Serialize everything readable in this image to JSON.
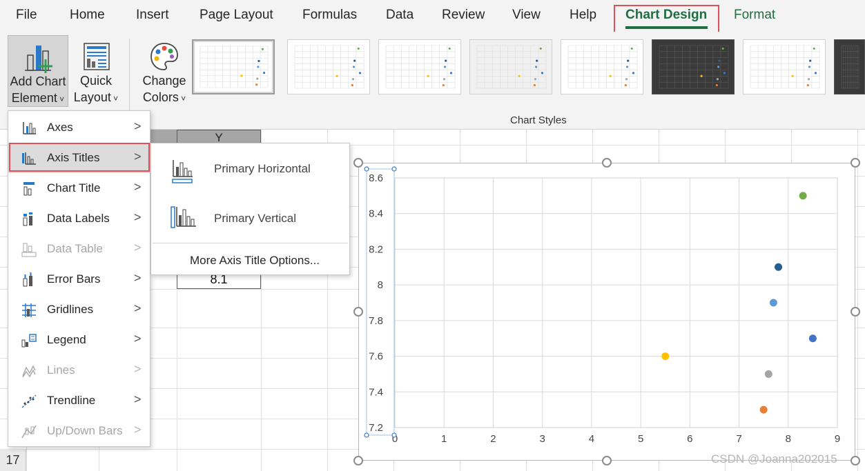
{
  "menu": {
    "tabs": [
      "File",
      "Home",
      "Insert",
      "Page Layout",
      "Formulas",
      "Data",
      "Review",
      "View",
      "Help",
      "Chart Design",
      "Format"
    ],
    "active": "Chart Design"
  },
  "ribbon": {
    "add_chart_element": {
      "line1": "Add Chart",
      "line2": "Element"
    },
    "quick_layout": {
      "line1": "Quick",
      "line2": "Layout"
    },
    "change_colors": {
      "line1": "Change",
      "line2": "Colors"
    },
    "chart_styles_label": "Chart Styles",
    "style_count": 8
  },
  "dropdown": {
    "items": [
      {
        "label": "Axes",
        "icon": "axes-icon",
        "enabled": true
      },
      {
        "label": "Axis Titles",
        "icon": "axis-titles-icon",
        "enabled": true
      },
      {
        "label": "Chart Title",
        "icon": "chart-title-icon",
        "enabled": true
      },
      {
        "label": "Data Labels",
        "icon": "data-labels-icon",
        "enabled": true
      },
      {
        "label": "Data Table",
        "icon": "data-table-icon",
        "enabled": false
      },
      {
        "label": "Error Bars",
        "icon": "error-bars-icon",
        "enabled": true
      },
      {
        "label": "Gridlines",
        "icon": "gridlines-icon",
        "enabled": true
      },
      {
        "label": "Legend",
        "icon": "legend-icon",
        "enabled": true
      },
      {
        "label": "Lines",
        "icon": "lines-icon",
        "enabled": false
      },
      {
        "label": "Trendline",
        "icon": "trendline-icon",
        "enabled": true
      },
      {
        "label": "Up/Down Bars",
        "icon": "up-down-bars-icon",
        "enabled": false
      }
    ],
    "hovered": "Axis Titles"
  },
  "submenu": {
    "primary_horizontal": "Primary Horizontal",
    "primary_vertical": "Primary Vertical",
    "more_options": "More Axis Title Options..."
  },
  "sheet": {
    "column_header": "Y",
    "cell_value": "8.1",
    "row_number": "17"
  },
  "chart_data": {
    "type": "scatter",
    "x_ticks": [
      "0",
      "1",
      "2",
      "3",
      "4",
      "5",
      "6",
      "7",
      "8",
      "9"
    ],
    "y_ticks": [
      "7.2",
      "7.4",
      "7.6",
      "7.8",
      "8",
      "8.2",
      "8.4",
      "8.6"
    ],
    "xlim": [
      0,
      9
    ],
    "ylim": [
      7.2,
      8.6
    ],
    "grid": true,
    "points": [
      {
        "x": 8.3,
        "y": 8.5,
        "color": "#70ad47"
      },
      {
        "x": 7.8,
        "y": 8.1,
        "color": "#255e91"
      },
      {
        "x": 7.7,
        "y": 7.9,
        "color": "#5b9bd5"
      },
      {
        "x": 8.5,
        "y": 7.7,
        "color": "#4472c4"
      },
      {
        "x": 5.5,
        "y": 7.6,
        "color": "#ffc000"
      },
      {
        "x": 7.6,
        "y": 7.5,
        "color": "#a5a5a5"
      },
      {
        "x": 7.5,
        "y": 7.3,
        "color": "#ed7d31"
      }
    ]
  },
  "watermark": "CSDN @Joanna202015"
}
